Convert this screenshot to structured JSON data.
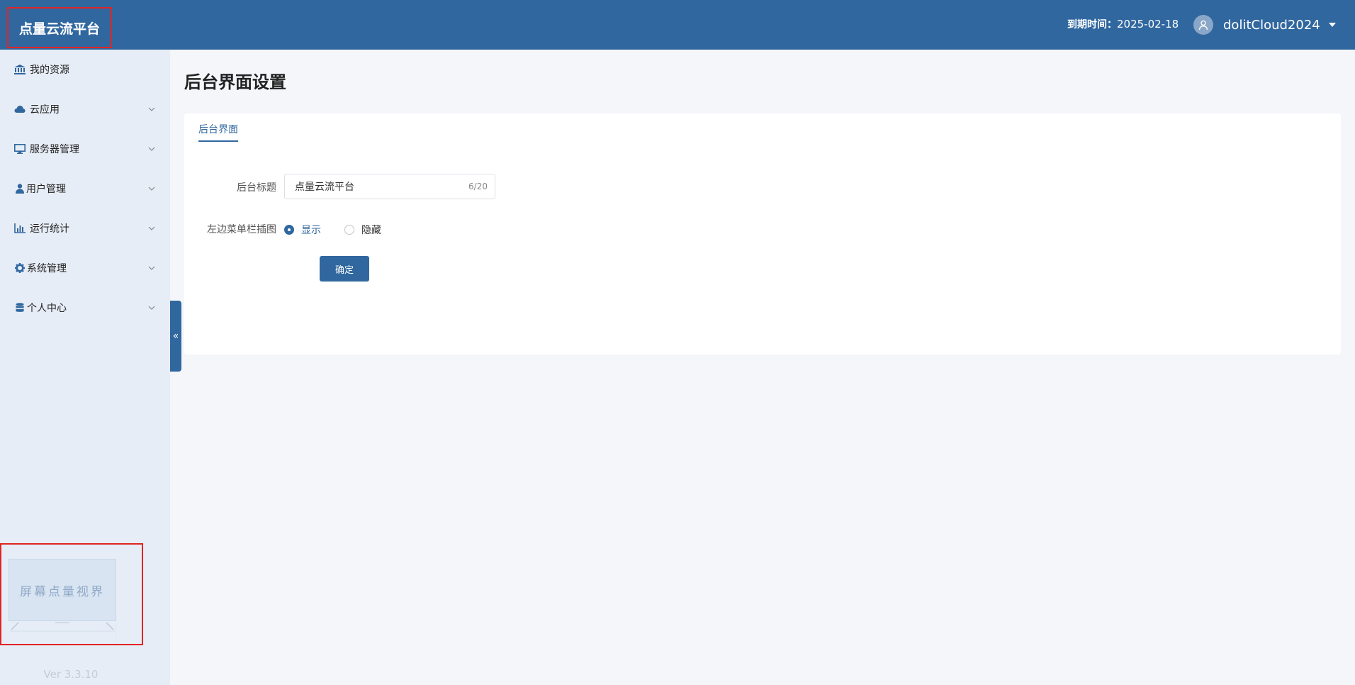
{
  "header": {
    "brand": "点量云流平台",
    "expire_label": "到期时间：",
    "expire_date": "2025-02-18",
    "username": "dolitCloud2024"
  },
  "sidebar": {
    "items": [
      {
        "label": "我的资源",
        "icon": "bank-icon",
        "has_chevron": false
      },
      {
        "label": "云应用",
        "icon": "cloud-icon",
        "has_chevron": true
      },
      {
        "label": "服务器管理",
        "icon": "monitor-icon",
        "has_chevron": true
      },
      {
        "label": "用户管理",
        "icon": "user-icon",
        "has_chevron": true
      },
      {
        "label": "运行统计",
        "icon": "bar-chart-icon",
        "has_chevron": true
      },
      {
        "label": "系统管理",
        "icon": "gear-icon",
        "has_chevron": true
      },
      {
        "label": "个人中心",
        "icon": "database-icon",
        "has_chevron": true
      }
    ],
    "illustration_text": "屏幕点量视界",
    "version": "Ver 3.3.10",
    "collapse_glyph": "«"
  },
  "main": {
    "title": "后台界面设置",
    "tab": "后台界面",
    "form": {
      "title_label": "后台标题",
      "title_value": "点量云流平台",
      "title_count": "6/20",
      "sidebar_image_label": "左边菜单栏插图",
      "options": [
        {
          "label": "显示",
          "checked": true
        },
        {
          "label": "隐藏",
          "checked": false
        }
      ],
      "submit": "确定"
    }
  },
  "colors": {
    "primary": "#31679f",
    "sidebar_bg": "#e7edf6",
    "highlight_border": "#e02424"
  }
}
